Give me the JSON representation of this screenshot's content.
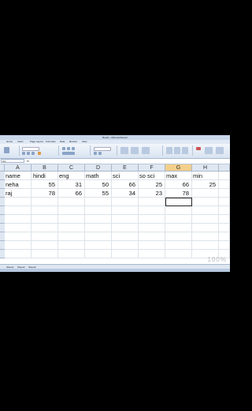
{
  "window": {
    "title": "Book1 - Microsoft Excel"
  },
  "ribbon_tabs": [
    "Home",
    "Insert",
    "Page Layout",
    "Formulas",
    "Data",
    "Review",
    "View"
  ],
  "name_box": "G3",
  "fx_label": "fx",
  "columns": [
    "A",
    "B",
    "C",
    "D",
    "E",
    "F",
    "G",
    "H"
  ],
  "selected_column": "G",
  "rows": [
    [
      "name",
      "hindi",
      "eng",
      "math",
      "sci",
      "so sci",
      "max",
      "min"
    ],
    [
      "neha",
      "55",
      "31",
      "50",
      "66",
      "25",
      "66",
      "25"
    ],
    [
      "raj",
      "78",
      "66",
      "55",
      "34",
      "23",
      "78",
      ""
    ]
  ],
  "sheet_tabs": [
    "Sheet1",
    "Sheet2",
    "Sheet3"
  ],
  "watermark": "100%"
}
